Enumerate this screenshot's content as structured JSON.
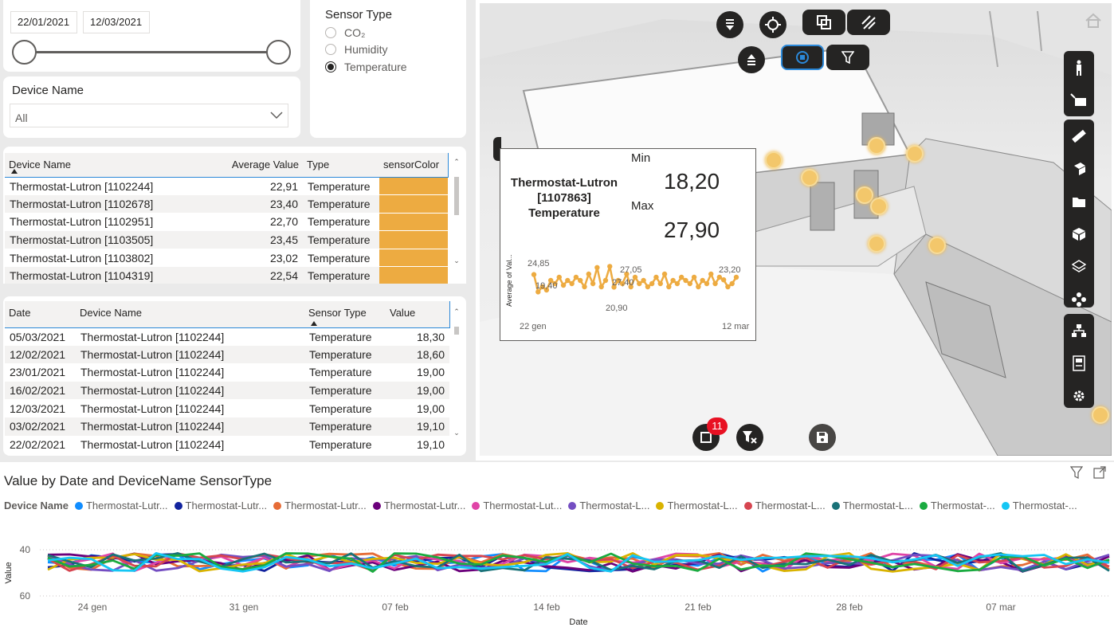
{
  "date_slicer": {
    "start": "22/01/2021",
    "end": "12/03/2021"
  },
  "sensor_type": {
    "title": "Sensor Type",
    "options": [
      {
        "label": "CO₂",
        "selected": false
      },
      {
        "label": "Humidity",
        "selected": false
      },
      {
        "label": "Temperature",
        "selected": true
      }
    ]
  },
  "device_name": {
    "title": "Device Name",
    "value": "All"
  },
  "summary_table": {
    "headers": [
      "Device Name",
      "Average Value",
      "Type",
      "sensorColor"
    ],
    "rows": [
      {
        "name": "Thermostat-Lutron [1102244]",
        "avg": "22,91",
        "type": "Temperature",
        "color": "#EDAB41"
      },
      {
        "name": "Thermostat-Lutron [1102678]",
        "avg": "23,40",
        "type": "Temperature",
        "color": "#EDAB41"
      },
      {
        "name": "Thermostat-Lutron [1102951]",
        "avg": "22,70",
        "type": "Temperature",
        "color": "#EDAB41"
      },
      {
        "name": "Thermostat-Lutron [1103505]",
        "avg": "23,45",
        "type": "Temperature",
        "color": "#EDAB41"
      },
      {
        "name": "Thermostat-Lutron [1103802]",
        "avg": "23,02",
        "type": "Temperature",
        "color": "#EDAB41"
      },
      {
        "name": "Thermostat-Lutron [1104319]",
        "avg": "22,54",
        "type": "Temperature",
        "color": "#EDAB41"
      }
    ]
  },
  "detail_table": {
    "headers": [
      "Date",
      "Device Name",
      "Sensor Type",
      "Value"
    ],
    "rows": [
      {
        "date": "05/03/2021",
        "name": "Thermostat-Lutron [1102244]",
        "type": "Temperature",
        "value": "18,30"
      },
      {
        "date": "12/02/2021",
        "name": "Thermostat-Lutron [1102244]",
        "type": "Temperature",
        "value": "18,60"
      },
      {
        "date": "23/01/2021",
        "name": "Thermostat-Lutron [1102244]",
        "type": "Temperature",
        "value": "19,00"
      },
      {
        "date": "16/02/2021",
        "name": "Thermostat-Lutron [1102244]",
        "type": "Temperature",
        "value": "19,00"
      },
      {
        "date": "12/03/2021",
        "name": "Thermostat-Lutron [1102244]",
        "type": "Temperature",
        "value": "19,00"
      },
      {
        "date": "03/02/2021",
        "name": "Thermostat-Lutron [1102244]",
        "type": "Temperature",
        "value": "19,10"
      },
      {
        "date": "22/02/2021",
        "name": "Thermostat-Lutron [1102244]",
        "type": "Temperature",
        "value": "19,10"
      }
    ]
  },
  "viewer": {
    "badge_count": "11",
    "tooltip": {
      "title": "Thermostat-Lutron [1107863] Temperature",
      "min_label": "Min",
      "min_value": "18,20",
      "max_label": "Max",
      "max_value": "27,90",
      "ylabel": "Average of Val...",
      "x_start": "22 gen",
      "x_end": "12 mar",
      "labels": [
        "24,85",
        "19,40",
        "27,05",
        "27,40",
        "20,90",
        "23,20"
      ],
      "sparkline": [
        24.85,
        19.4,
        21,
        20,
        23,
        22,
        24,
        21.5,
        23,
        22,
        24,
        23,
        21,
        25,
        22,
        27.05,
        21,
        23,
        27.4,
        20.9,
        23,
        22,
        25,
        21,
        24,
        22,
        23,
        21,
        22,
        24,
        22,
        25,
        21,
        23,
        22,
        24,
        23,
        22,
        24,
        21,
        23,
        22,
        25,
        22,
        24,
        23.2,
        21,
        22,
        24
      ]
    }
  },
  "chart_data": {
    "type": "line",
    "title": "Value by Date and DeviceName SensorType",
    "xlabel": "Date",
    "ylabel": "Value",
    "ylim": [
      40,
      60
    ],
    "yticks": [
      "40",
      "60"
    ],
    "xticks": [
      "24 gen",
      "31 gen",
      "07 feb",
      "14 feb",
      "21 feb",
      "28 feb",
      "07 mar"
    ],
    "legend_title": "Device Name",
    "legend_position": "top",
    "series": [
      {
        "name": "Thermostat-Lutr...",
        "color": "#118DFF"
      },
      {
        "name": "Thermostat-Lutr...",
        "color": "#12239E"
      },
      {
        "name": "Thermostat-Lutr...",
        "color": "#E66C37"
      },
      {
        "name": "Thermostat-Lutr...",
        "color": "#6B007B"
      },
      {
        "name": "Thermostat-Lut...",
        "color": "#E044A7"
      },
      {
        "name": "Thermostat-L...",
        "color": "#744EC2"
      },
      {
        "name": "Thermostat-L...",
        "color": "#D9B300"
      },
      {
        "name": "Thermostat-L...",
        "color": "#D64550"
      },
      {
        "name": "Thermostat-L...",
        "color": "#197278"
      },
      {
        "name": "Thermostat-...",
        "color": "#1AAB40"
      },
      {
        "name": "Thermostat-...",
        "color": "#15C6F4"
      }
    ]
  }
}
